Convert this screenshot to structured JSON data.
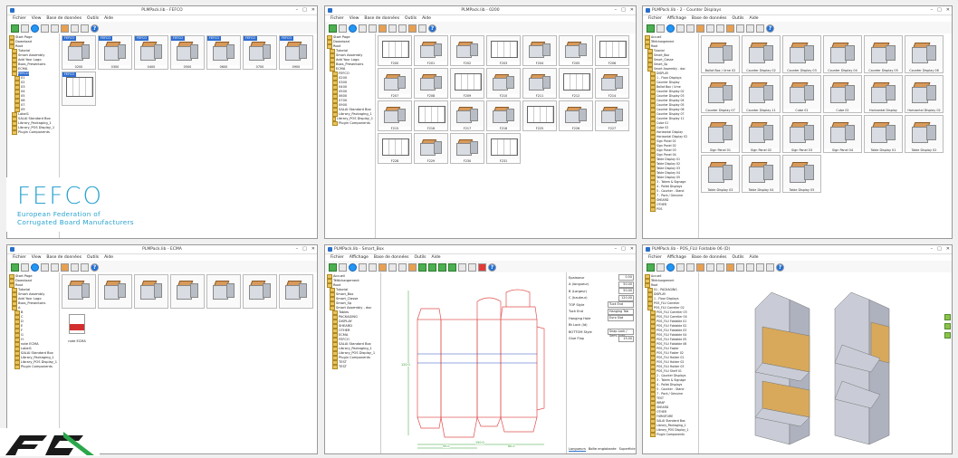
{
  "colors": {
    "accent": "#2a6fc9",
    "fefco_blue": "#2aa3cf",
    "kraft": "#d89a5a",
    "cad_red": "#e05050",
    "cad_green": "#30a030"
  },
  "menu": [
    "Fichier",
    "View",
    "Base de données",
    "Outils",
    "Aide"
  ],
  "menu_fr": [
    "Fichier",
    "Affichage",
    "Base de données",
    "Outils",
    "Aide"
  ],
  "windows": {
    "w1": {
      "title": "PLMPack.lib - FEFCO",
      "tree": [
        "Start Page",
        "Download",
        "Root",
        "Tutorial",
        "Smart Assembly",
        "Add Your Logo",
        "Boxs_Presentoirs",
        "ECMA",
        "FEFCO",
        "01",
        "02",
        "03",
        "04",
        "05",
        "06",
        "07",
        "09",
        "Label1",
        "SALAI Standard Box",
        "Library_Packaging_1",
        "Library_POS Display_1",
        "Plugin Components"
      ],
      "tags": [
        "FEFCO",
        "FEFCO",
        "FEFCO",
        "FEFCO",
        "FEFCO",
        "FEFCO",
        "FEFCO",
        "FEFCO"
      ],
      "captions": [
        "0200",
        "0300",
        "0400",
        "0500",
        "0600",
        "0700",
        "0900"
      ]
    },
    "w2": {
      "title": "PLMPack.lib - 0200",
      "tree": [
        "Start Page",
        "Download",
        "Root",
        "Tutorial",
        "Smart Assembly",
        "Add Your Logo",
        "Boxs_Presentoirs",
        "ECMA",
        "FEFCO",
        "0200",
        "0300",
        "0400",
        "0500",
        "0600",
        "0700",
        "0900",
        "SALAI Standard Box",
        "Library_Packaging_1",
        "Library_POS Display_1",
        "Plugin Components"
      ],
      "captions": [
        "F200",
        "F201",
        "F202",
        "F203",
        "F204",
        "F205",
        "F206",
        "F207",
        "F208",
        "F209",
        "F210",
        "F211",
        "F212",
        "F214",
        "F215",
        "F216",
        "F217",
        "F218",
        "F225",
        "F226",
        "F227",
        "F228",
        "F229",
        "F230",
        "F231"
      ]
    },
    "w3": {
      "title": "PLMPack.lib - 2 - Counter Displays",
      "tree": [
        "Accueil",
        "Téléchargement",
        "Root",
        "Tutorial",
        "Smart_Box",
        "Smart_Classe",
        "Smart_Sp",
        "Smart Assembly - doc",
        "DISPLAY",
        "1 - Floor Displays",
        "Counter Display",
        "Ballot Box / Urne",
        "Counter Display 02",
        "Counter Display 03",
        "Counter Display 04",
        "Counter Display 05",
        "Counter Display 06",
        "Counter Display 07",
        "Counter Display 11",
        "Cube 01",
        "Cube 02",
        "Horizontal Display",
        "Horizontal Display 02",
        "Sign Panel 01",
        "Sign Panel 02",
        "Sign Panel 03",
        "Sign Panel 04",
        "Table Display 01",
        "Table Display 02",
        "Table Display 03",
        "Table Display 04",
        "Table Display 05",
        "3 - Totem & Signage",
        "4 - Pallet Displays",
        "5 - Counter - Stand",
        "7 - Pack / Genuine",
        "SHEARD",
        "OTHER",
        "POS"
      ],
      "captions": [
        "Ballot Box / Urne 02",
        "Counter Display 02",
        "Counter Display 03",
        "Counter Display 04",
        "Counter Display 05",
        "Counter Display 06",
        "Counter Display 07",
        "Counter Display 11",
        "Cube 01",
        "Cube 02",
        "Horizontal Display",
        "Horizontal Display 02",
        "Sign Panel 01",
        "Sign Panel 02",
        "Sign Panel 03",
        "Sign Panel 04",
        "Table Display 01",
        "Table Display 02",
        "Table Display 03",
        "Table Display 04",
        "Table Display 05"
      ]
    },
    "w4": {
      "title": "PLMPack.lib - ECMA",
      "tree": [
        "Start Page",
        "Download",
        "Root",
        "Tutorial",
        "Smart Assembly",
        "Add Your Logo",
        "Boxs_Presentoirs",
        "A",
        "B",
        "C",
        "D",
        "E",
        "F",
        "G",
        "H",
        "note ECMA",
        "Label1",
        "SALAI Standard Box",
        "Library_Packaging_1",
        "Library_POS Display_1",
        "Plugin Components"
      ],
      "pdf_label": "note ECMA"
    },
    "w5": {
      "title": "PLMPack.lib - Smart_Box",
      "tree": [
        "Accueil",
        "Téléchargement",
        "Root",
        "Tutorial",
        "Smart_Box",
        "Smart_Classe",
        "Smart_Sp",
        "Smart Assembly - doc",
        "Tables",
        "PACKAGING",
        "DISPLAY",
        "SHEARD",
        "OTHER",
        "ECMA",
        "FEFCO",
        "SALAI Standard Box",
        "Library_Packaging_1",
        "Library_POS Display_1",
        "Plugin Components",
        "TEST",
        "TEST"
      ],
      "props": [
        {
          "label": "Epaisseur",
          "value": "0.50"
        },
        {
          "label": "A (longueur)",
          "value": "50.00"
        },
        {
          "label": "B (Largeur)",
          "value": "50.00"
        },
        {
          "label": "C (hauteur)",
          "value": "120.00"
        }
      ],
      "selects": [
        {
          "label": "TOP Style",
          "value": "Tuck End"
        },
        {
          "label": "Tuck End",
          "value": "Hanging Tab"
        },
        {
          "label": "Hanging Hole",
          "value": "Euro Slot"
        },
        {
          "label": "Bt Lock (Id)",
          "value": ""
        },
        {
          "label": "BOTTOM Style",
          "value": "Snap Lock / Semi Auto"
        }
      ],
      "glue": {
        "label": "Glue Flap",
        "value": "15.00"
      },
      "tabs": [
        "Longueurs",
        "Boîte englobante",
        "Superficie"
      ],
      "dims": [
        "150.0",
        "50.0",
        "60.0",
        "120.0"
      ]
    },
    "w6": {
      "title": "PLMPack.lib - POS_FLU Foldable 06 (D)",
      "tree": [
        "Accueil",
        "Téléchargement",
        "Root",
        "01 - PACKAGING",
        "DISPLAY",
        "1 - Floor Displays",
        "POS_FLU Carrelier",
        "POS_FLU Carrelier 02",
        "POS_FLU Carrelier 03",
        "POS_FLU Carrelier 04",
        "POS_FLU Foldable 01",
        "POS_FLU Foldable 02",
        "POS_FLU Foldable 03",
        "POS_FLU Foldable 04",
        "POS_FLU Foldable 05",
        "POS_FLU Foldable 06",
        "POS_FLU Foster",
        "POS_FLU Foster 02",
        "POS_FLU Holder 01",
        "POS_FLU Holder 02",
        "POS_FLU Holder 03",
        "POS_FLU Shelf 01",
        "2 - Counter Displays",
        "3 - Totem & Signage",
        "4 - Pallet Displays",
        "5 - Counter - Stand",
        "7 - Pack / Genuine",
        "TEST",
        "WRAP",
        "SHEARD",
        "OTHER",
        "FURNITURE",
        "SALAI Standard Box",
        "Library_Packaging_1",
        "Library_POS Display_1",
        "Plugin Components"
      ]
    }
  },
  "logos": {
    "fefco": {
      "word": "FEFCO",
      "line1": "European Federation of",
      "line2": "Corrugated Board Manufacturers"
    },
    "ec": {
      "word": "EC"
    }
  }
}
